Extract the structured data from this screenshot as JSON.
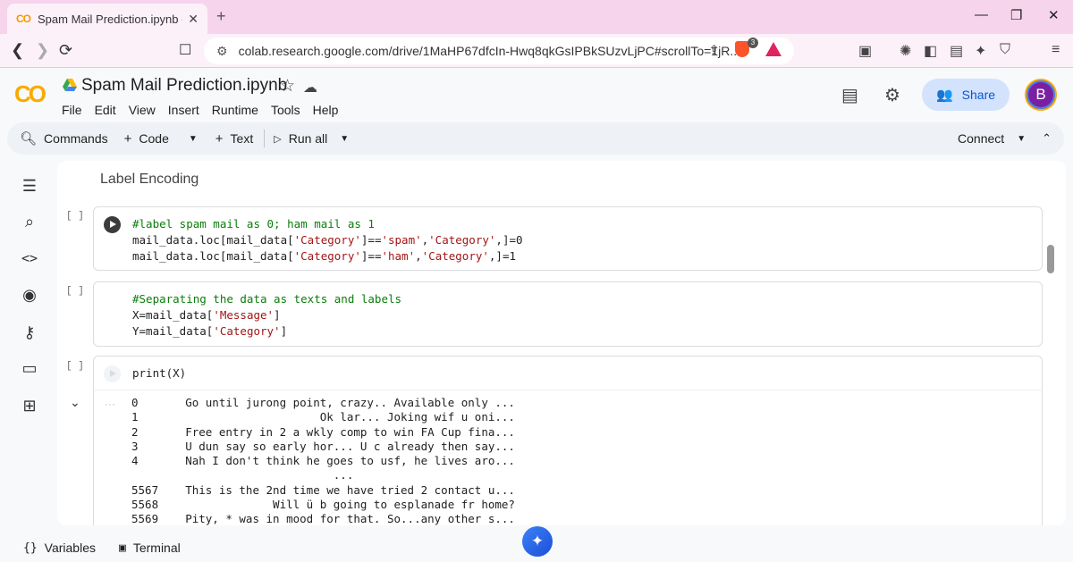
{
  "browser": {
    "tab_title": "Spam Mail Prediction.ipynb - Co",
    "tab_logo": "CO",
    "url": "colab.research.google.com/drive/1MaHP67dfcIn-Hwq8qkGsIPBkSUzvLjPC#scrollTo=1jR...",
    "brave_badge": "3",
    "win_minimize": "—",
    "win_restore": "❐",
    "win_close": "✕"
  },
  "header": {
    "logo": "CO",
    "notebook_title": "Spam Mail Prediction.ipynb",
    "menu": [
      "File",
      "Edit",
      "View",
      "Insert",
      "Runtime",
      "Tools",
      "Help"
    ],
    "share_label": "Share",
    "avatar_letter": "B"
  },
  "toolbar": {
    "commands": "Commands",
    "code": "Code",
    "text": "Text",
    "run_all": "Run all",
    "connect": "Connect"
  },
  "notebook": {
    "section_heading": "Label Encoding",
    "exec_marker": "[ ]",
    "cell1_lines": [
      "#label spam mail as 0; ham mail as 1",
      "mail_data.loc[mail_data['Category']=='spam','Category',]=0",
      "mail_data.loc[mail_data['Category']=='ham','Category',]=1"
    ],
    "cell2_lines": [
      "#Separating the data as texts and labels",
      "X=mail_data['Message']",
      "Y=mail_data['Category']"
    ],
    "cell3_code": "print(X)",
    "output_dots": "···",
    "output": "0       Go until jurong point, crazy.. Available only ...\n1                           Ok lar... Joking wif u oni...\n2       Free entry in 2 a wkly comp to win FA Cup fina...\n3       U dun say so early hor... U c already then say...\n4       Nah I don't think he goes to usf, he lives aro...\n                              ...\n5567    This is the 2nd time we have tried 2 contact u...\n5568                 Will ü b going to esplanade fr home?\n5569    Pity, * was in mood for that. So...any other s..."
  },
  "statusbar": {
    "variables": "Variables",
    "terminal": "Terminal"
  },
  "colors": {
    "tab_strip": "#f6d4ec",
    "share_bg": "#d3e3fd",
    "comment": "#0a7d0a",
    "string": "#a31515",
    "colab_orange": "#f9ab00"
  }
}
